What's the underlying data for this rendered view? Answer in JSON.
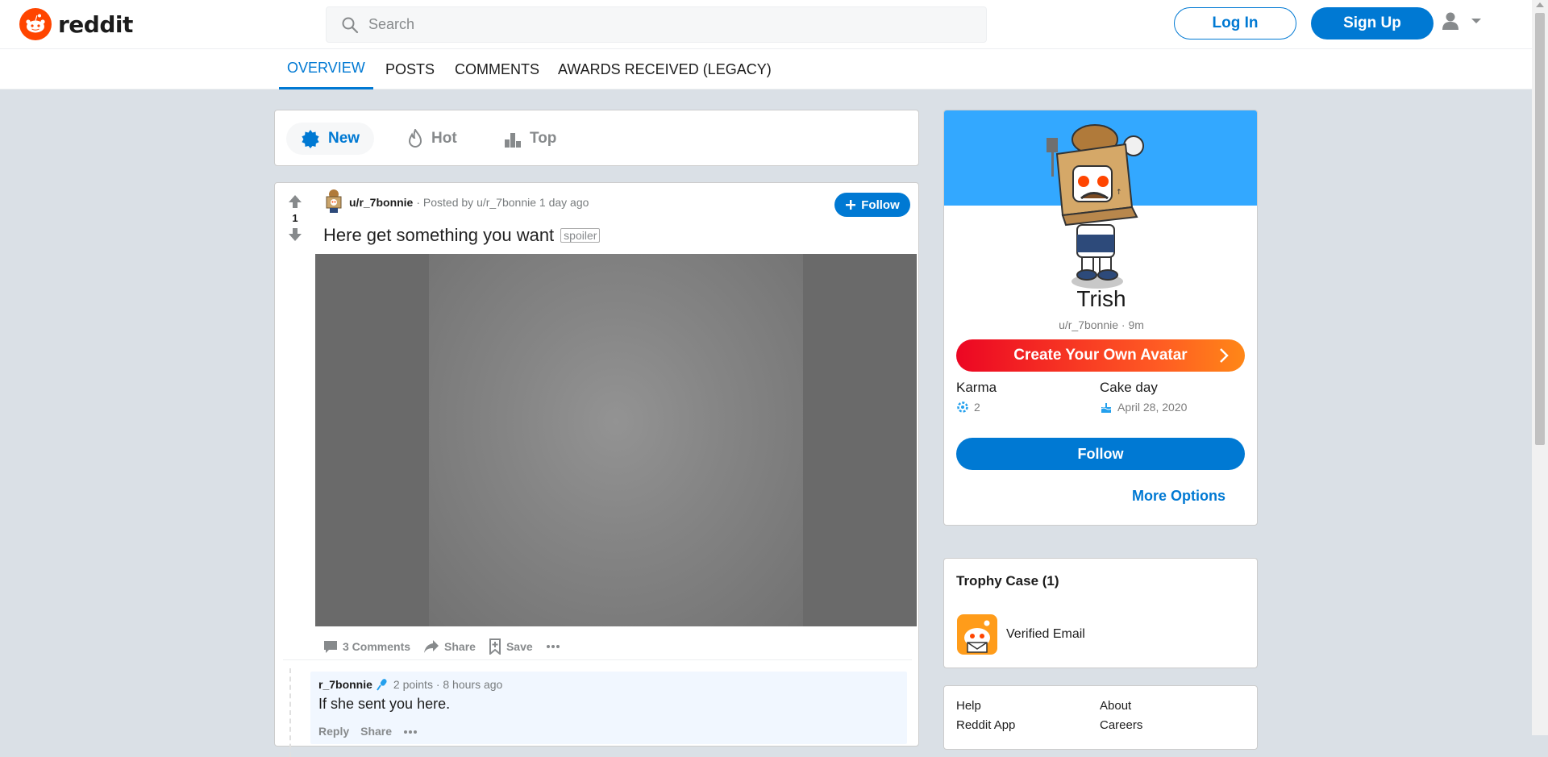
{
  "header": {
    "logo_text": "reddit",
    "search_placeholder": "Search",
    "login_label": "Log In",
    "signup_label": "Sign Up"
  },
  "profile_tabs": [
    "OVERVIEW",
    "POSTS",
    "COMMENTS",
    "AWARDS RECEIVED (LEGACY)"
  ],
  "sort": {
    "new": "New",
    "hot": "Hot",
    "top": "Top"
  },
  "post": {
    "author": "u/r_7bonnie",
    "posted_by": "· Posted by u/r_7bonnie 1 day ago",
    "follow_label": "Follow",
    "votes": "1",
    "title": "Here get something you want",
    "tag": "spoiler",
    "comments_label": "3 Comments",
    "share_label": "Share",
    "save_label": "Save"
  },
  "comment": {
    "author": "r_7bonnie",
    "meta": "2 points · 8 hours ago",
    "text": "If she sent you here.",
    "reply_label": "Reply",
    "share_label": "Share"
  },
  "profile": {
    "display_name": "Trish",
    "username_line": "u/r_7bonnie · 9m",
    "avatar_button": "Create Your Own Avatar",
    "karma_label": "Karma",
    "karma_value": "2",
    "cake_label": "Cake day",
    "cake_value": "April 28, 2020",
    "follow_label": "Follow",
    "more_options": "More Options"
  },
  "trophy": {
    "title": "Trophy Case (1)",
    "item": "Verified Email"
  },
  "footer": {
    "help": "Help",
    "about": "About",
    "app": "Reddit App",
    "careers": "Careers"
  },
  "colors": {
    "accent": "#0079d3",
    "brand": "#ff4500",
    "banner": "#33a8ff"
  }
}
